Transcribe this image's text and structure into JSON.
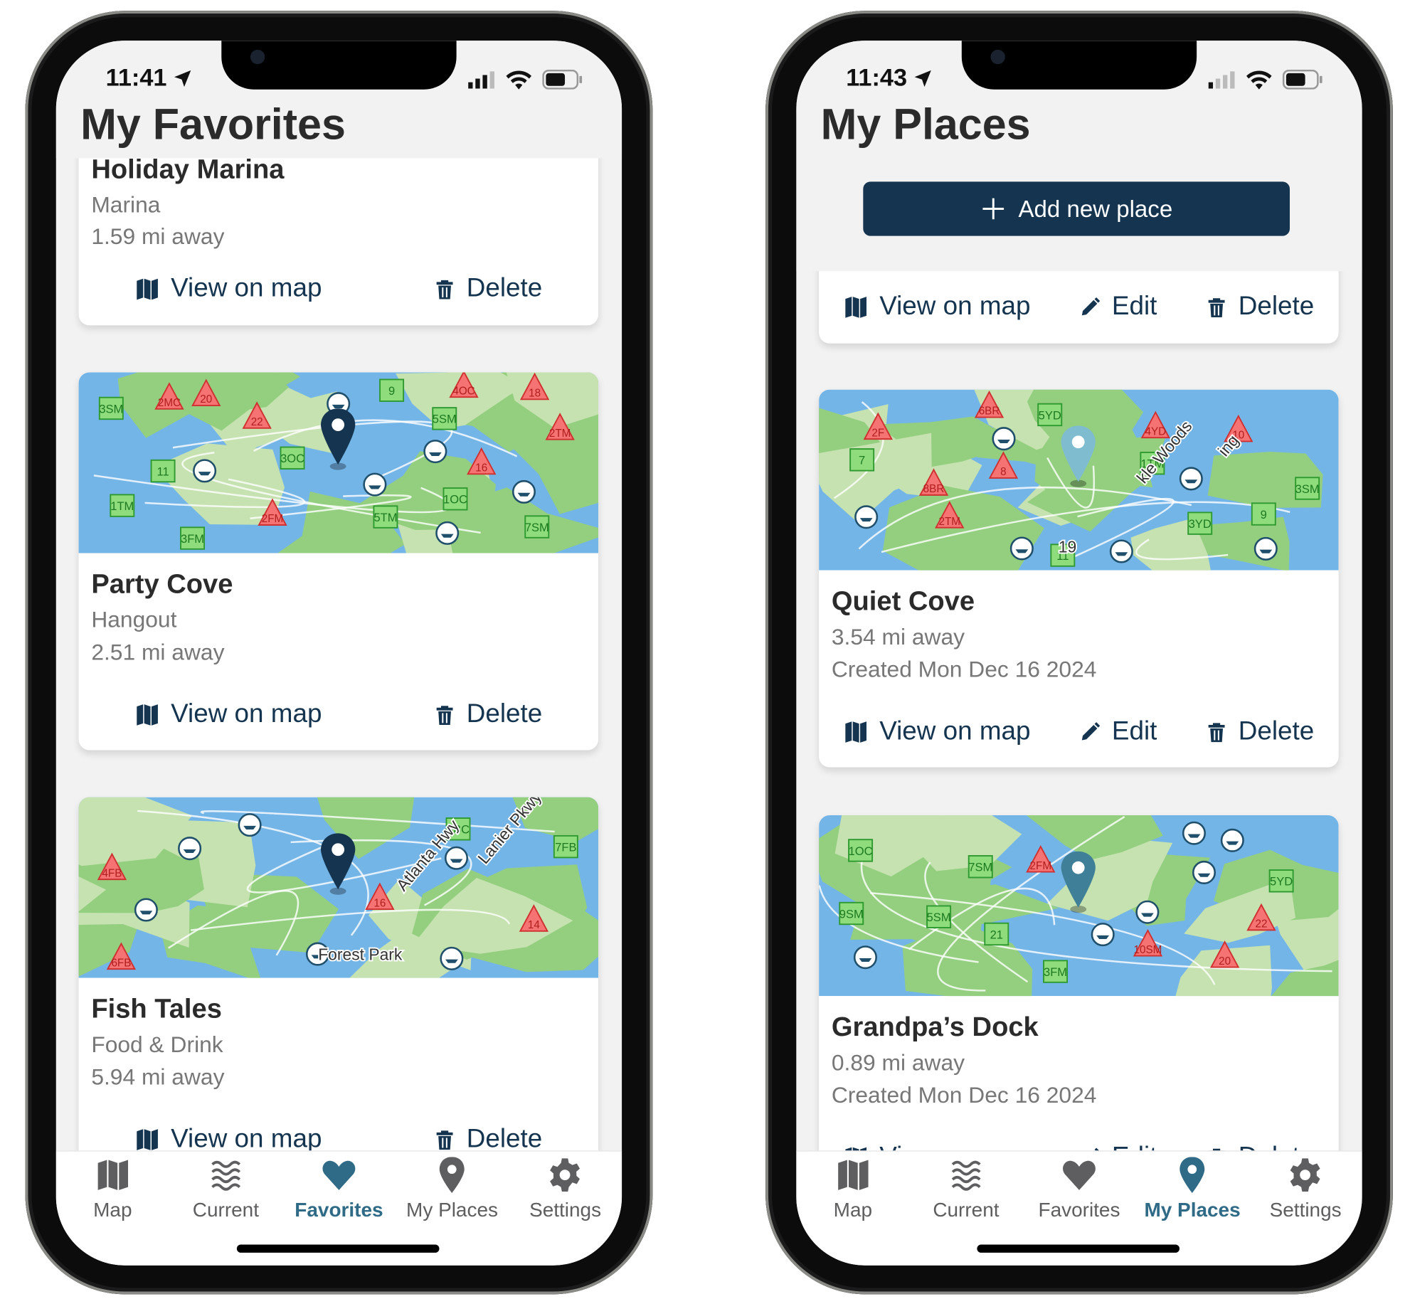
{
  "colors": {
    "accent": "#14344f",
    "tab_active": "#2f6a86",
    "tab_inactive": "#5e5e60",
    "water": "#74b5e8",
    "land": "#93cf7e",
    "pin_dark": "#14344f",
    "pin_light": "#7fbcd0",
    "pin_teal": "#3f7f98"
  },
  "tabs": [
    {
      "label": "Map",
      "icon": "map-icon"
    },
    {
      "label": "Current",
      "icon": "waves-icon"
    },
    {
      "label": "Favorites",
      "icon": "heart-icon"
    },
    {
      "label": "My Places",
      "icon": "pin-icon"
    },
    {
      "label": "Settings",
      "icon": "gear-icon"
    }
  ],
  "left": {
    "status_time": "11:41",
    "title": "My Favorites",
    "active_tab": "Favorites",
    "actions": {
      "view": "View on map",
      "delete": "Delete"
    },
    "cards": [
      {
        "name": "Holiday Marina",
        "category": "Marina",
        "distance": "1.59 mi away"
      },
      {
        "name": "Party Cove",
        "category": "Hangout",
        "distance": "2.51 mi away",
        "map": {
          "pin": "pin_dark",
          "labels": [],
          "green": [
            "7SM",
            "3FM",
            "5SM",
            "5TM",
            "3SM",
            "1TM",
            "1OC",
            "3OC",
            "9",
            "11"
          ],
          "red": [
            "2FM",
            "20",
            "22",
            "2MC",
            "18",
            "4OC",
            "2TM",
            "16"
          ]
        }
      },
      {
        "name": "Fish Tales",
        "category": "Food & Drink",
        "distance": "5.94 mi away",
        "map": {
          "pin": "pin_dark",
          "labels": [
            "Atlanta Hwy",
            "Lanier Pkwy",
            "Forest Park"
          ],
          "green": [
            "7FB",
            "3BC"
          ],
          "red": [
            "16",
            "14",
            "4FB",
            "6FB"
          ]
        }
      }
    ]
  },
  "right": {
    "status_time": "11:43",
    "title": "My Places",
    "active_tab": "My Places",
    "add_button": "Add new place",
    "actions": {
      "view": "View on map",
      "edit": "Edit",
      "delete": "Delete"
    },
    "cards": [
      {},
      {
        "name": "Quiet Cove",
        "distance": "3.54 mi away",
        "created": "Created Mon Dec 16 2024",
        "map": {
          "pin": "pin_light",
          "labels": [
            "kle Woods",
            "ing",
            "19"
          ],
          "green": [
            "5YD",
            "3SM",
            "1TM",
            "3YD",
            "9",
            "7",
            "11"
          ],
          "red": [
            "4YD",
            "8BR",
            "6BR",
            "2TM",
            "10",
            "8",
            "2F"
          ]
        }
      },
      {
        "name": "Grandpa’s Dock",
        "distance": "0.89 mi away",
        "created": "Created Mon Dec 16 2024",
        "map": {
          "pin": "pin_teal",
          "labels": [],
          "green": [
            "9SM",
            "7SM",
            "3FM",
            "5SM",
            "5YD",
            "21",
            "1OC"
          ],
          "red": [
            "10SM",
            "2FM",
            "22",
            "20"
          ]
        }
      }
    ]
  }
}
